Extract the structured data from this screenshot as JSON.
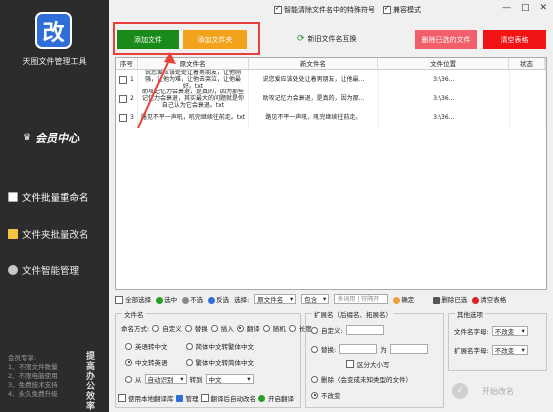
{
  "app": {
    "logo_char": "改",
    "logo_tag": "",
    "title": "天图文件管理工具",
    "vip_label": "会员中心"
  },
  "nav": [
    {
      "label": "文件批量重命名"
    },
    {
      "label": "文件夹批量改名"
    },
    {
      "label": "文件智能管理"
    }
  ],
  "vip_notes": [
    "会员专享:",
    "1、不限文件数量",
    "2、不限电脑使用",
    "3、免费技术支持",
    "4、永久免费升级"
  ],
  "vip_vertical": [
    "提",
    "高",
    "办",
    "公",
    "效",
    "率"
  ],
  "titlebar": {
    "option1": "智能清除文件名中的特殊符号",
    "option2": "兼容模式",
    "controls": [
      "—",
      "□",
      "✕"
    ]
  },
  "toolbar": {
    "add_file": "添加文件",
    "add_folder": "添加文件夹",
    "new_old": "新旧文件名互换",
    "delete_done": "删除已选的文件",
    "clear_table": "清空表格"
  },
  "table": {
    "headers": [
      "序号",
      "原文件名",
      "新文件名",
      "文件位置",
      "状态"
    ],
    "rows": [
      {
        "no": "1",
        "orig": "说您爱应该处处让着男朋友，让他刚强，让他为难，让他去哭泣，让他最好。txt",
        "new": "说您爱应该处处让着男朋友，让他最...",
        "loc": "3:\\36...",
        "status": ""
      },
      {
        "no": "2",
        "orig": "助攻记忆力会衰退，是真的，因为那些记忆力会衰退，其实最大的问题就是你自己认为它会衰退。txt",
        "new": "助攻记忆力会衰退，是真的，因为那...",
        "loc": "3:\\36...",
        "status": ""
      },
      {
        "no": "3",
        "orig": "路见不平一声吼，吼完继续往前走。txt",
        "new": "路见不平一声吼，吼完继续往前走。",
        "loc": "3:\\36...",
        "status": ""
      }
    ]
  },
  "actionbar": {
    "select_all": "全部选择",
    "select": "选中",
    "unselect": "不选",
    "invert": "反选",
    "choose": "选择:",
    "scope": "原文件名",
    "match": "包含",
    "pattern_placeholder": "多词用 | 符隔开",
    "confirm": "确定",
    "delete_selected": "删除已选",
    "clear_table": "清空表格"
  },
  "filename_panel": {
    "title": "文件名",
    "mode_label": "命名方式:",
    "modes": [
      "自定义",
      "替换",
      "插入",
      "翻译",
      "随机",
      "长度"
    ],
    "modes_checked": "翻译",
    "row2": [
      "英语转中文",
      "简体中文转繁体中文"
    ],
    "row3": [
      "中文转英语",
      "繁体中文转简体中文"
    ],
    "row3_checked": "中文转英语",
    "from_label": "从",
    "from_value": "自动识别",
    "to_label": "转到",
    "to_value": "中文",
    "use_local": "使用本地翻译库",
    "manage": "管理",
    "translate_then_name": "翻译后自动改名",
    "open_translation": "开启翻译"
  },
  "ext_panel": {
    "title": "扩展名（后缀名、拓展名）",
    "custom": "自定义:",
    "replace": "替换:",
    "replace_to": "为",
    "case": "区分大小写",
    "delete": "删除（会变成未知类型的文件）",
    "unchanged": "不改变",
    "checked": "不改变"
  },
  "other_panel": {
    "title": "其他选项",
    "name_case_label": "文件名字母:",
    "name_case_value": "不改变",
    "ext_case_label": "扩展名字母:",
    "ext_case_value": "不改变"
  },
  "start": {
    "label": "开始改名"
  }
}
